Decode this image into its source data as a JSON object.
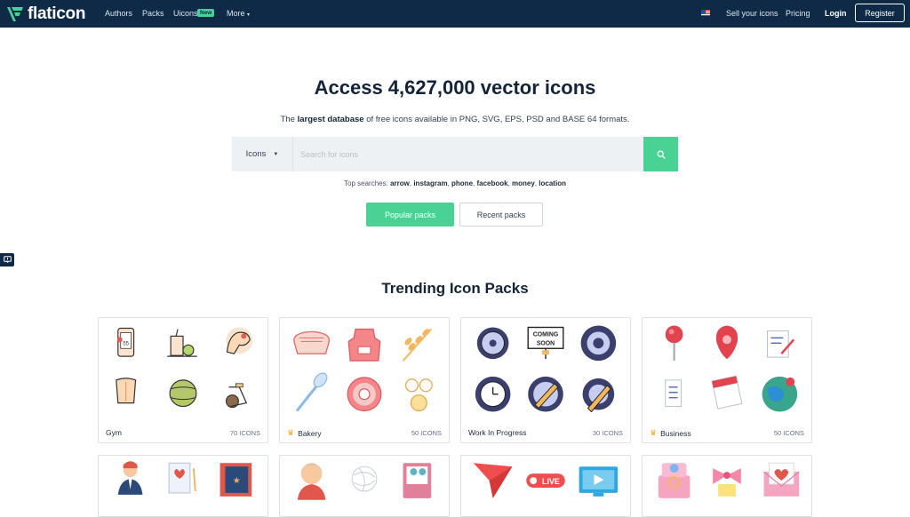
{
  "nav": {
    "logo_text": "flaticon",
    "links": [
      "Authors",
      "Packs",
      "Uicons",
      "More"
    ],
    "badge": "New",
    "sell": "Sell your icons",
    "pricing": "Pricing",
    "login": "Login",
    "register": "Register",
    "brand_color": "#0e2a47",
    "accent_color": "#4ad295"
  },
  "hero": {
    "title": "Access 4,627,000 vector icons",
    "sub_prefix": "The ",
    "sub_bold": "largest database",
    "sub_suffix": " of free icons available in PNG, SVG, EPS, PSD and BASE 64 formats."
  },
  "search": {
    "type_label": "Icons",
    "placeholder": "Search for icons",
    "value": ""
  },
  "top_searches": {
    "label": "Top searches:",
    "terms": [
      "arrow",
      "instagram",
      "phone",
      "facebook",
      "money",
      "location"
    ]
  },
  "buttons": {
    "popular": "Popular packs",
    "recent": "Recent packs"
  },
  "trending": {
    "title": "Trending Icon Packs",
    "packs": [
      {
        "name": "Gym",
        "count": "70 ICONS",
        "premium": false
      },
      {
        "name": "Bakery",
        "count": "50 ICONS",
        "premium": true
      },
      {
        "name": "Work In Progress",
        "count": "30 ICONS",
        "premium": false
      },
      {
        "name": "Business",
        "count": "50 ICONS",
        "premium": true
      }
    ]
  }
}
